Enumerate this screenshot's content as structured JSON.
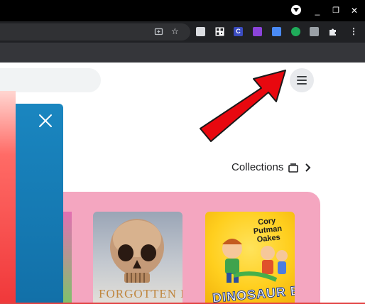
{
  "browser": {
    "window_controls": {
      "minimize_glyph": "_",
      "restore_glyph": "❐",
      "close_glyph": "✕"
    },
    "toolbar": {
      "icons": [
        "screenshot-icon",
        "star-icon",
        "extension-dark-icon",
        "extension-qr-icon",
        "extension-c-icon",
        "extension-puzzle-purple-icon",
        "extension-blue-square-icon",
        "extension-green-circle-icon",
        "extension-folder-icon",
        "puzzle-icon",
        "kebab-menu-icon"
      ],
      "star_glyph": "☆",
      "kebab_glyph": "⋮",
      "c_label": "C"
    }
  },
  "page": {
    "collections_label": "Collections",
    "books": [
      {
        "name": "forgotten-bones",
        "title": "FORGOTTEN BONES"
      },
      {
        "name": "dinosaur-boy",
        "title": "DINOSAUR BOY",
        "author": "Cory Putman Oakes"
      }
    ]
  },
  "colors": {
    "annotation_arrow": "#e8080f",
    "shelf": "#f4a6c0",
    "panel": "#1a86c0"
  }
}
